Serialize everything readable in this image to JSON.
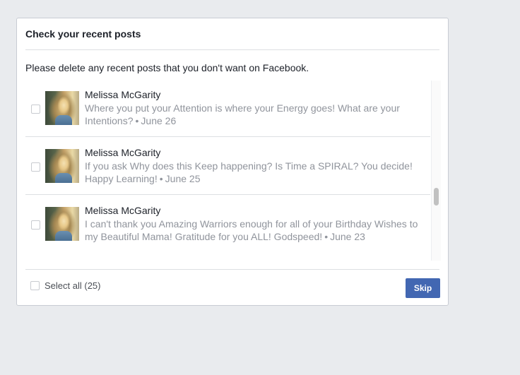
{
  "dialog": {
    "title": "Check your recent posts",
    "instructions": "Please delete any recent posts that you don't want on Facebook."
  },
  "posts": [
    {
      "author": "Melissa McGarity",
      "text": "Where you put your Attention is where your Energy goes! What are your Intentions?",
      "separator": "•",
      "date": "June 26"
    },
    {
      "author": "Melissa McGarity",
      "text": "If you ask Why does this Keep happening? Is Time a SPIRAL? You decide! Happy Learning!",
      "separator": "•",
      "date": "June 25"
    },
    {
      "author": "Melissa McGarity",
      "text": "I can't thank you Amazing Warriors enough for all of your Birthday Wishes to my Beautiful Mama! Gratitude for you ALL! Godspeed!",
      "separator": "•",
      "date": "June 23"
    }
  ],
  "footer": {
    "select_all_label": "Select all (25)",
    "skip_label": "Skip"
  },
  "colors": {
    "primary_button": "#4267b2",
    "background": "#e9ebee",
    "muted_text": "#90949c"
  }
}
